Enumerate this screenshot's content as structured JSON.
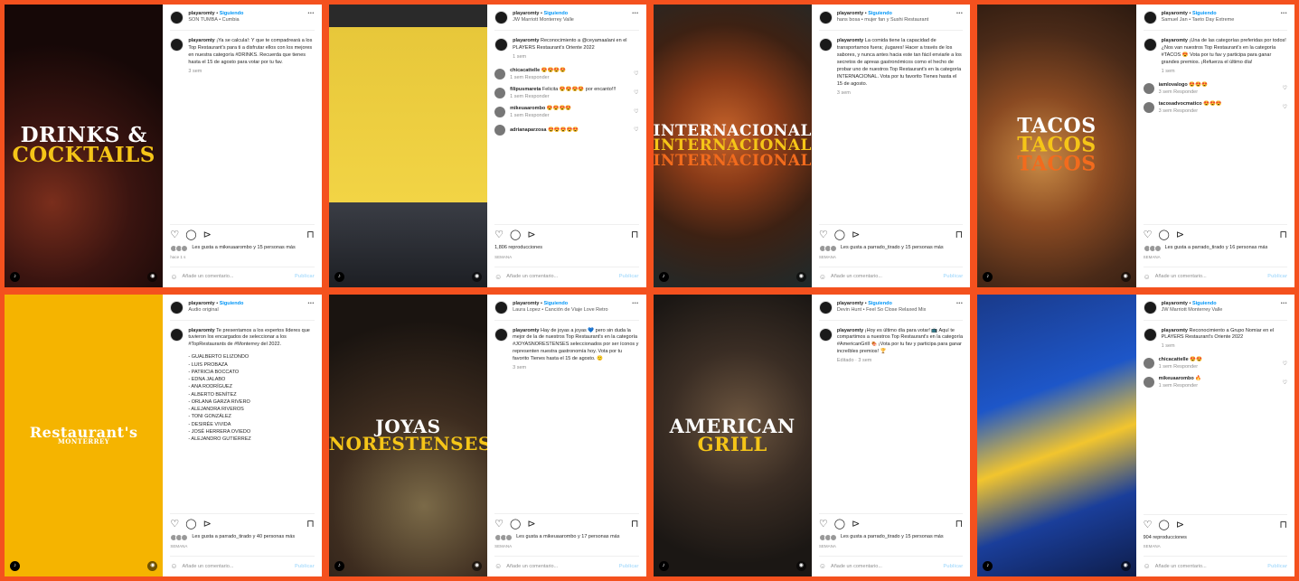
{
  "follow_label": "Siguiendo",
  "add_comment_placeholder": "Añade un comentario...",
  "publish_label": "Publicar",
  "icons": {
    "like": "heart-icon",
    "comment": "comment-icon",
    "share": "send-icon",
    "save": "bookmark-icon"
  },
  "posts": [
    {
      "user": "playaromty",
      "sub": "SON TUMBA • Cumbia",
      "caption_user": "playaromty",
      "caption": "¡Ya se calcula!: Y que te compadreará a los Top Restaurant's para ti a disfrutar ellos con los mejores en nuestra categoría #DRINKS. Recuerda que tienes hasta el 15 de agosto para votar por tu fav.",
      "caption_meta": "3 sem",
      "comments": [],
      "likes": "Les gusta a mikeuaarombo y 15 personas más",
      "date": "hace 1 s",
      "overlay": [
        [
          "DRINKS &",
          "w"
        ],
        [
          "COCKTAILS",
          "y"
        ]
      ],
      "overlay_size": 23
    },
    {
      "user": "playaromty",
      "sub": "JW Marriott Monterrey Valle",
      "caption_user": "playaromty",
      "caption": "Reconocimiento a @ceyamaalani en el PLAYERS Restaurant's Oriente 2022",
      "caption_meta": "1 sem",
      "comments": [
        {
          "user": "chicacattelle",
          "text": "😍😍😍😍",
          "meta": "1 sem   Responder"
        },
        {
          "user": "filipusmareta",
          "text": "Felicita 😍😍😍😍 por encanto!!!",
          "meta": "1 sem   Responder"
        },
        {
          "user": "mikeuaarombo",
          "text": "😍😍😍😍",
          "meta": "1 sem   Responder"
        },
        {
          "user": "adrianaparzosa",
          "text": "😍😍😍😍😍",
          "meta": ""
        }
      ],
      "likes": "1,806 reproducciones",
      "date": "SEMANA",
      "overlay": [],
      "overlay_size": 0
    },
    {
      "user": "playaromty",
      "sub": "hans bosa • mujer fan y Sushi Restaurant",
      "caption_user": "playaromty",
      "caption": "La comida tiene la capacidad de transportarnos fuera; ¡lugares! Hacer a través de los sabores, y nunca antes hacia este tan fácil enviarle a los secretos de apreas gastronómicos como el hecho de probar uno de nuestros Top Restaurant's en la categoría INTERNACIONAL. Vota por tu favorito Tienes hasta el 15 de agosto.",
      "caption_meta": "3 sem",
      "comments": [],
      "likes": "Les gusta a parrado_tirado y 15 personas más",
      "date": "SEMANA",
      "overlay": [
        [
          "INTERNACIONAL",
          "w"
        ],
        [
          "INTERNACIONAL",
          "y"
        ],
        [
          "INTERNACIONAL",
          "o"
        ]
      ],
      "overlay_size": 17
    },
    {
      "user": "playaromty",
      "sub": "Samuel Jan • Taeto Day Extreme",
      "caption_user": "playaromty",
      "caption": "¡Una de las categorías preferidas por todos! ¿Nos van nuestros Top Restaurant's en la categoría #TACOS 😍 Vota por tu fav y participa para ganar grandes premios. ¡Refuerza el último día!",
      "caption_meta": "1 sem",
      "comments": [
        {
          "user": "iamlovalogo",
          "text": "😍😍😍",
          "meta": "3 sem   Responder"
        },
        {
          "user": "tacosadvocmatico",
          "text": "😍😍😍",
          "meta": "3 sem   Responder"
        }
      ],
      "likes": "Les gusta a parrado_tirado y 16 personas más",
      "date": "SEMANA",
      "overlay": [
        [
          "TACOS",
          "w"
        ],
        [
          "TACOS",
          "y"
        ],
        [
          "TACOS",
          "o"
        ]
      ],
      "overlay_size": 22
    },
    {
      "user": "playaromty",
      "sub": "Audio original",
      "caption_user": "playaromty",
      "caption": "Te presentamos a los expertos líderes que tuvieron los encargados de seleccionar a los #TopRestaurants de #Monterrey del 2022.",
      "caption_meta": "",
      "list": [
        "- GUALBERTO ELIZONDO",
        "- LUIS PROBAZA",
        "- PATRICIA BOCCATO",
        "- EDNA JALABO",
        "- ANA RODRÍGUEZ",
        "- ALBERTO BENÍTEZ",
        "- ORLANA GARZA RIVERO",
        "- ALEJANDRA RIVEROS",
        "- TONI GONZÁLEZ",
        "- DESIRÉE VIVIDA",
        "- JOSÉ HERRERA OVIEDO",
        "- ALEJANDRO GUTIÉRREZ"
      ],
      "comments": [],
      "likes": "Les gusta a parrado_tirado y 40 personas más",
      "date": "SEMANA",
      "overlay": [
        [
          "Restaurant's",
          "w"
        ],
        [
          "MONTERREY",
          "w"
        ]
      ],
      "overlay_size": 16
    },
    {
      "user": "playaromty",
      "sub": "Laura Lopez • Canción de Viaje Love Retro",
      "caption_user": "playaromty",
      "caption": "Hay de joyas a joyas 💙 pero sin duda la mejor de la de nuestros Top Restaurant's en la categoría #JOYASNORESTENSES seleccionados por ser íconos y representen nuestra gastronomía hoy. Vota por tu favorito Tienes hasta el 15 de agosto. 🙂",
      "caption_meta": "3 sem",
      "comments": [],
      "likes": "Les gusta a mikeuaarombo y 17 personas más",
      "date": "SEMANA",
      "overlay": [
        [
          "JOYAS",
          "w"
        ],
        [
          "NORESTENSES",
          "y"
        ]
      ],
      "overlay_size": 20
    },
    {
      "user": "playaromty",
      "sub": "Devin Hunt • Feel So Close Relaxed Mix",
      "caption_user": "playaromty",
      "caption": "¡Hoy es último día para votar! 📺 Aquí te compartimos a nuestros Top Restaurant's en la categoría #AmericanGrill 🍖 ¡Vota por tu fav y participa para ganar increíbles premios! 🏆",
      "caption_meta": "Editado · 3 sem",
      "comments": [],
      "likes": "Les gusta a parrado_tirado y 15 personas más",
      "date": "SEMANA",
      "overlay": [
        [
          "AMERICAN",
          "w"
        ],
        [
          "GRILL",
          "y"
        ]
      ],
      "overlay_size": 21
    },
    {
      "user": "playaromty",
      "sub": "JW Marriott Monterrey Valle",
      "caption_user": "playaromty",
      "caption": "Reconocimiento a Grupo Nomiar en el PLAYERS Restaurant's Oriente 2022",
      "caption_meta": "1 sem",
      "comments": [
        {
          "user": "chicacattelle",
          "text": "😍😍",
          "meta": "1 sem   Responder"
        },
        {
          "user": "mikeuaarombo",
          "text": "🔥",
          "meta": "1 sem   Responder"
        }
      ],
      "likes": "904 reproducciones",
      "date": "SEMANA",
      "overlay": [],
      "overlay_size": 0
    }
  ]
}
